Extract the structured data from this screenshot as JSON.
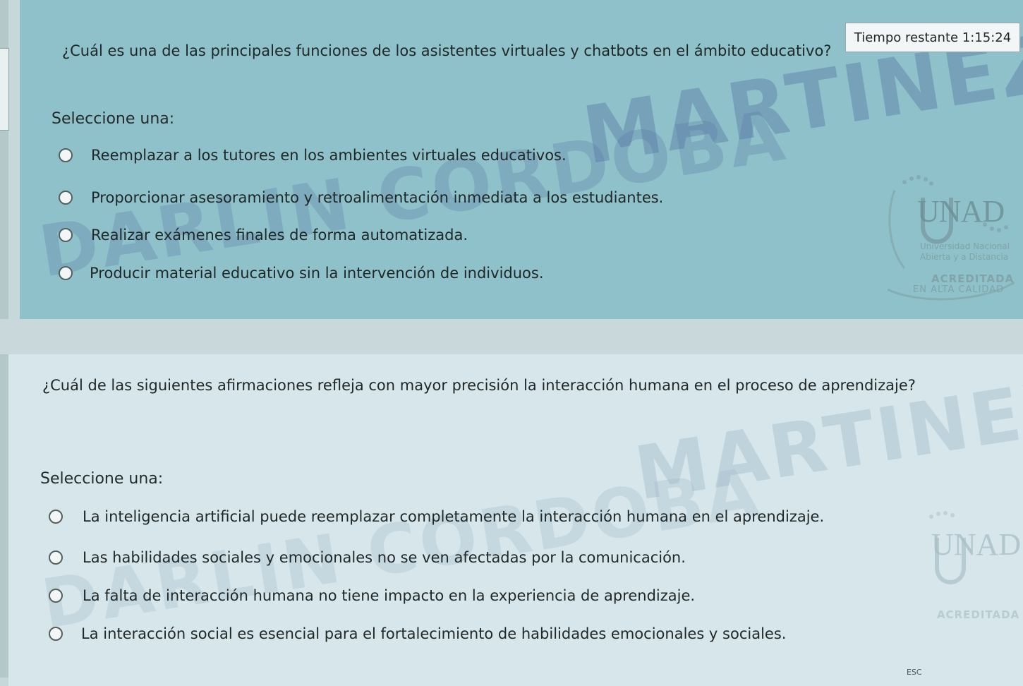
{
  "timer": {
    "label": "Tiempo restante",
    "value": "1:15:24"
  },
  "watermark": {
    "top": "MARTINEZ",
    "bottom": "DARLIN CORDOBA"
  },
  "logo": {
    "name": "UNAD",
    "line1": "Universidad Nacional",
    "line2": "Abierta y a Distancia",
    "line3": "ACREDITADA",
    "line4": "EN ALTA CALIDAD"
  },
  "questions": [
    {
      "text": "¿Cuál es una de las principales funciones de los asistentes virtuales y chatbots en el ámbito educativo?",
      "select_label": "Seleccione una:",
      "options": [
        "Reemplazar a los tutores en los ambientes virtuales educativos.",
        "Proporcionar asesoramiento y retroalimentación inmediata a los estudiantes.",
        "Realizar exámenes finales de forma automatizada.",
        "Producir material educativo sin la intervención de individuos."
      ]
    },
    {
      "text": "¿Cuál de las siguientes afirmaciones refleja con mayor precisión la interacción humana en el proceso de aprendizaje?",
      "select_label": "Seleccione una:",
      "options": [
        "La inteligencia artificial puede reemplazar completamente la interacción humana en el aprendizaje.",
        "Las habilidades sociales y emocionales no se ven afectadas por la comunicación.",
        "La falta de interacción humana no tiene impacto en la experiencia de aprendizaje.",
        "La interacción social es esencial para el fortalecimiento de habilidades emocionales y sociales."
      ]
    }
  ],
  "hint": "ESC",
  "colors": {
    "question_bg": "#8ec1c9",
    "question2_bg": "#d6e6ea",
    "timer_bg": "#f3f6f6"
  }
}
